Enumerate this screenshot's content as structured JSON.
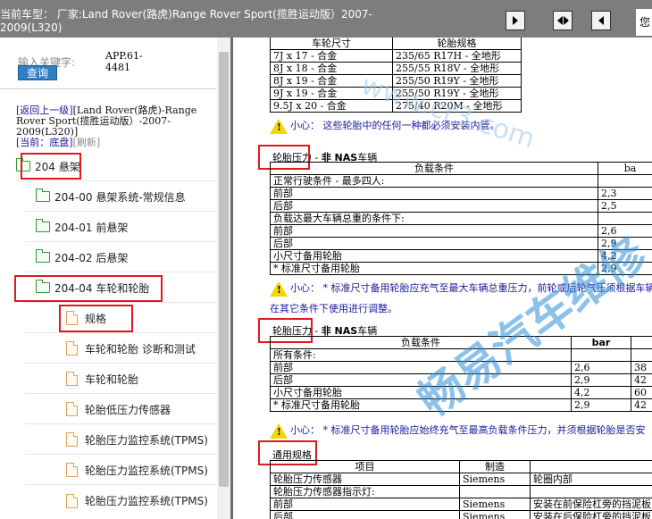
{
  "header": {
    "title": "当前车型： 厂家:Land Rover(路虎)Range Rover Sport(揽胜运动版）2007-2009(L320)",
    "user_label": "您"
  },
  "search": {
    "label": "输入关键字:",
    "button": "查询",
    "app_code": "APP.61-4481"
  },
  "breadcrumb": {
    "back": "[返回上一级]",
    "model": "[Land Rover(路虎)-Range Rover Sport(揽胜运动版）-2007-2009(L320)]",
    "current_prefix": "[当前：",
    "current_value": "底盘",
    "current_suffix": "]",
    "refresh": "[刷新]"
  },
  "tree": [
    {
      "label": "204 悬架",
      "icon": "folder-icon"
    },
    {
      "label": "204-00 悬架系统-常规信息",
      "icon": "folder-icon"
    },
    {
      "label": "204-01 前悬架",
      "icon": "folder-icon"
    },
    {
      "label": "204-02 后悬架",
      "icon": "folder-icon"
    },
    {
      "label": "204-04 车轮和轮胎",
      "icon": "folder-icon"
    },
    {
      "label": "规格",
      "icon": "document-icon"
    },
    {
      "label": "车轮和轮胎 诊断和测试",
      "icon": "document-icon"
    },
    {
      "label": "车轮和轮胎",
      "icon": "document-icon"
    },
    {
      "label": "轮胎低压力传感器",
      "icon": "document-icon"
    },
    {
      "label": "轮胎压力监控系统(TPMS)",
      "icon": "document-icon"
    },
    {
      "label": "轮胎压力监控系统(TPMS)",
      "icon": "document-icon"
    },
    {
      "label": "轮胎压力监控系统(TPMS)",
      "icon": "document-icon"
    }
  ],
  "doc": {
    "wheel_table": {
      "headers": [
        "车轮尺寸",
        "轮胎规格"
      ],
      "rows": [
        [
          "7J x 17 - 合金",
          "235/65 R17H - 全地形"
        ],
        [
          "8J x 18 - 合金",
          "255/55 R18V - 全地形"
        ],
        [
          "8J x 19 - 合金",
          "255/50 R19Y - 全地形"
        ],
        [
          "9J x 19 - 合金",
          "255/50 R19Y - 全地形"
        ],
        [
          "9.5J x 20 - 合金",
          "275/40 R20M - 全地形"
        ]
      ]
    },
    "note1": "小心： 这些轮胎中的任何一种都必须安装内管。",
    "sec1_title_prefix": "轮胎压力 - ",
    "sec1_title_bold": "非 NAS",
    "sec1_title_suffix": "车辆",
    "table1": {
      "headers": [
        "负载条件",
        "ba"
      ],
      "rows": [
        [
          "正常行驶条件 - 最多四人:",
          ""
        ],
        [
          "前部",
          "2,3"
        ],
        [
          "后部",
          "2,5"
        ],
        [
          "负载达最大车辆总重的条件下:",
          ""
        ],
        [
          "前部",
          "2,6"
        ],
        [
          "后部",
          "2,9"
        ],
        [
          "小尺寸备用轮胎",
          "4,2"
        ],
        [
          "* 标准尺寸备用轮胎",
          "2,9"
        ]
      ]
    },
    "note2": "小心： * 标准尺寸备用轮胎应充气至最大车辆总重压力，前轮或后轮气压须根据车辆",
    "note2b": "在其它条件下使用进行调整。",
    "sec2_title_prefix": "轮胎压力 - ",
    "sec2_title_bold": "非 NAS",
    "sec2_title_suffix": "车辆",
    "table2": {
      "headers": [
        "负载条件",
        "bar",
        ""
      ],
      "rows": [
        [
          "所有条件:",
          "",
          ""
        ],
        [
          "前部",
          "2,6",
          "38"
        ],
        [
          "后部",
          "2,9",
          "42"
        ],
        [
          "小尺寸备用轮胎",
          "4,2",
          "60"
        ],
        [
          "* 标准尺寸备用轮胎",
          "2,9",
          "42"
        ]
      ]
    },
    "note3": "小心： * 标准尺寸备用轮胎应始终充气至最高负载条件压力，并须根据轮胎是否安",
    "sec3_title": "通用规格",
    "table3": {
      "headers": [
        "项目",
        "制造",
        ""
      ],
      "rows": [
        [
          "轮胎压力传感器",
          "Siemens",
          "轮圈内部"
        ],
        [
          "轮胎压力传感器指示灯:",
          "",
          ""
        ],
        [
          "前部",
          "Siemens",
          "安装在前保险杠旁的挡泥板"
        ],
        [
          "后部",
          "Siemens",
          "安装在后保险杠旁的挡泥板"
        ]
      ]
    },
    "watermark": "畅易汽车维修",
    "watermark_url": "www.cr3.com"
  }
}
